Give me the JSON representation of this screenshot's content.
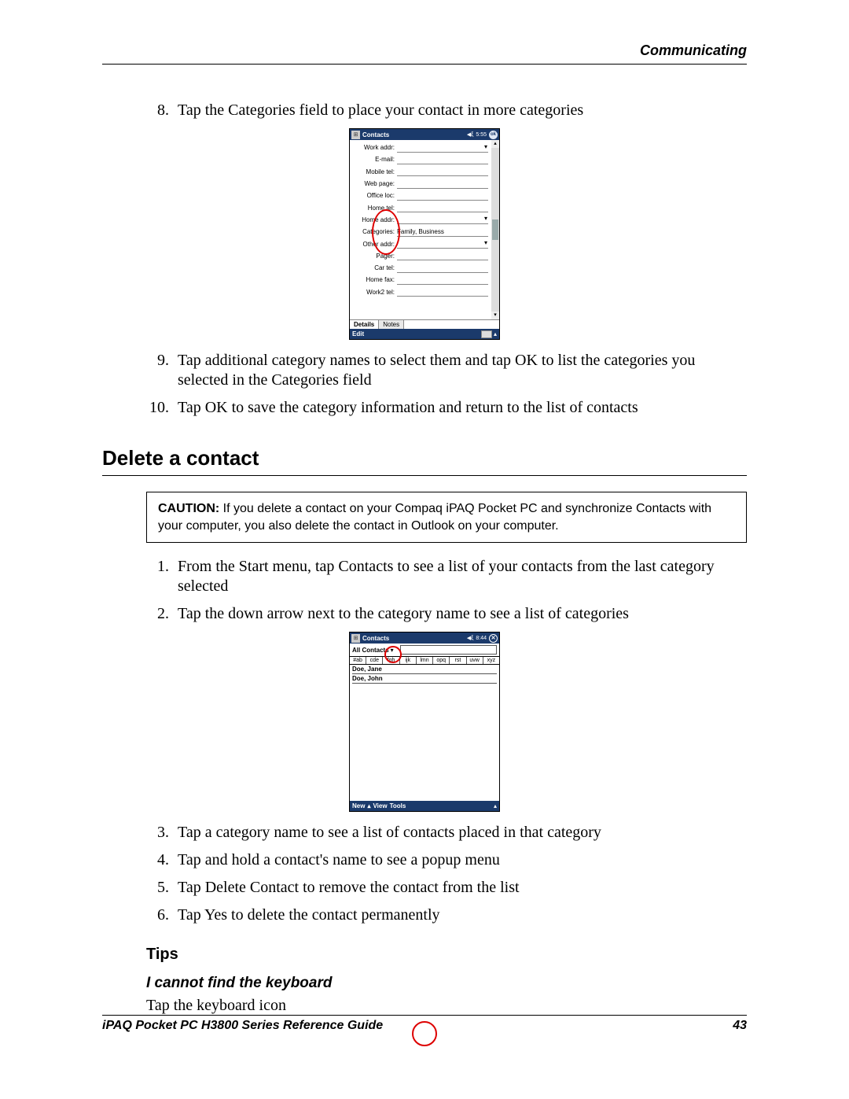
{
  "header": {
    "running": "Communicating"
  },
  "list_a": {
    "start": 8,
    "items": [
      "Tap the Categories field to place your contact in more categories",
      "Tap additional category names to select them and tap OK to list the categories you selected in the Categories field",
      "Tap OK to save the category information and return to the list of contacts"
    ]
  },
  "section_title": "Delete a contact",
  "caution": {
    "label": "CAUTION:",
    "text": "If you delete a contact on your Compaq iPAQ Pocket PC and synchronize Contacts with your computer, you also delete the contact in Outlook on your computer."
  },
  "list_b": {
    "start": 1,
    "items": [
      "From the Start menu, tap Contacts to see a list of your contacts from the last category selected",
      "Tap the down arrow next to the category name to see a list of categories",
      "Tap a category name to see a list of contacts placed in that category",
      "Tap and hold a contact's name to see a popup menu",
      "Tap Delete Contact to remove the contact from the list",
      "Tap Yes to delete the contact permanently"
    ]
  },
  "tips_heading": "Tips",
  "subtip_heading": "I cannot find the keyboard",
  "subtip_body": "Tap the keyboard icon",
  "footer": {
    "left": "iPAQ Pocket PC H3800 Series Reference Guide",
    "right": "43"
  },
  "device1": {
    "title": "Contacts",
    "time": "5:55",
    "ok": "ok",
    "fields": [
      {
        "label": "Work addr:",
        "dd": true,
        "val": ""
      },
      {
        "label": "E-mail:",
        "dd": false,
        "val": ""
      },
      {
        "label": "Mobile tel:",
        "dd": false,
        "val": ""
      },
      {
        "label": "Web page:",
        "dd": false,
        "val": ""
      },
      {
        "label": "Office loc:",
        "dd": false,
        "val": ""
      },
      {
        "label": "Home tel:",
        "dd": false,
        "val": ""
      },
      {
        "label": "Home addr:",
        "dd": true,
        "val": ""
      },
      {
        "label": "Categories:",
        "dd": false,
        "val": "Family, Business"
      },
      {
        "label": "Other addr:",
        "dd": true,
        "val": ""
      },
      {
        "label": "Pager:",
        "dd": false,
        "val": ""
      },
      {
        "label": "Car tel:",
        "dd": false,
        "val": ""
      },
      {
        "label": "Home fax:",
        "dd": false,
        "val": ""
      },
      {
        "label": "Work2 tel:",
        "dd": false,
        "val": ""
      }
    ],
    "tabs": [
      "Details",
      "Notes"
    ],
    "edit": "Edit"
  },
  "device2": {
    "title": "Contacts",
    "time": "8:44",
    "selector": "All Contacts",
    "alpha": [
      "#ab",
      "cde",
      "fgh",
      "ijk",
      "lmn",
      "opq",
      "rst",
      "uvw",
      "xyz"
    ],
    "names": [
      "Doe, Jane",
      "Doe, John"
    ],
    "menus": [
      "New",
      "View",
      "Tools"
    ]
  }
}
